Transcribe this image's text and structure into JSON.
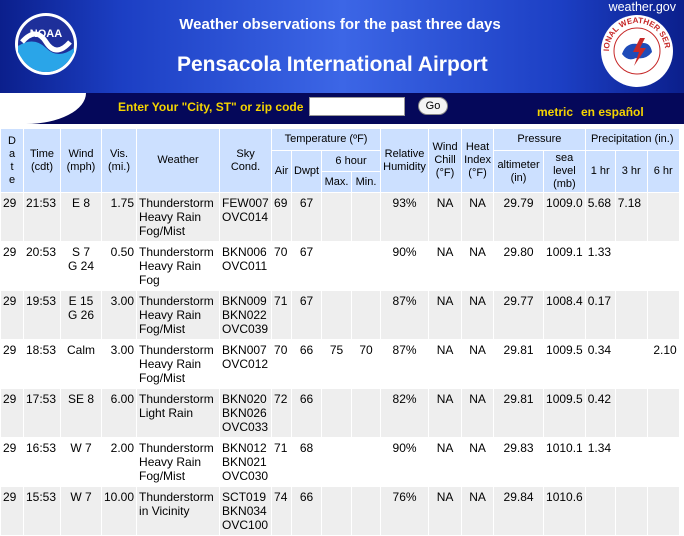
{
  "header": {
    "site_link": "weather.gov",
    "subtitle": "Weather observations for the past three days",
    "title": "Pensacola International Airport",
    "noaa_logo_text": "NOAA",
    "nws_logo_text": "NATIONAL WEATHER SERVICE"
  },
  "search": {
    "label": "Enter Your \"City, ST\" or zip code",
    "value": "",
    "go_label": "Go",
    "metric_label": "metric",
    "espanol_label": "en español"
  },
  "colors": {
    "header_blue": "#1c3fc4",
    "search_bar": "#05085a",
    "link_yellow": "#f5d400",
    "table_header": "#cce0ff",
    "row_shade": "#eeeeee"
  },
  "table": {
    "headers": {
      "date": [
        "D",
        "a",
        "t",
        "e"
      ],
      "time": [
        "Time",
        "(cdt)"
      ],
      "wind": [
        "Wind",
        "(mph)"
      ],
      "vis": [
        "Vis.",
        "(mi.)"
      ],
      "weather": "Weather",
      "sky": [
        "Sky",
        "Cond."
      ],
      "temperature": "Temperature (ºF)",
      "air": "Air",
      "dwpt": "Dwpt",
      "six_hour": "6 hour",
      "max": "Max.",
      "min": "Min.",
      "humidity": [
        "Relative",
        "Humidity"
      ],
      "wind_chill": [
        "Wind",
        "Chill",
        "(°F)"
      ],
      "heat_index": [
        "Heat",
        "Index",
        "(°F)"
      ],
      "pressure": "Pressure",
      "altimeter": [
        "altimeter",
        "(in)"
      ],
      "sea_level": [
        "sea",
        "level",
        "(mb)"
      ],
      "precipitation": "Precipitation (in.)",
      "p1": "1 hr",
      "p3": "3 hr",
      "p6": "6 hr"
    },
    "rows": [
      {
        "date": "29",
        "time": "21:53",
        "wind": [
          "E 8"
        ],
        "vis": "1.75",
        "weather": [
          "Thunderstorm",
          "Heavy Rain",
          "Fog/Mist"
        ],
        "sky": [
          "FEW007",
          "OVC014"
        ],
        "air": "69",
        "dwpt": "67",
        "max": "",
        "min": "",
        "humidity": "93%",
        "wind_chill": "NA",
        "heat_index": "NA",
        "altimeter": "29.79",
        "sea_level": "1009.0",
        "p1": "5.68",
        "p3": "7.18",
        "p6": ""
      },
      {
        "date": "29",
        "time": "20:53",
        "wind": [
          "S 7",
          "G 24"
        ],
        "vis": "0.50",
        "weather": [
          "Thunderstorm",
          "Heavy Rain",
          "Fog"
        ],
        "sky": [
          "BKN006",
          "OVC011"
        ],
        "air": "70",
        "dwpt": "67",
        "max": "",
        "min": "",
        "humidity": "90%",
        "wind_chill": "NA",
        "heat_index": "NA",
        "altimeter": "29.80",
        "sea_level": "1009.1",
        "p1": "1.33",
        "p3": "",
        "p6": ""
      },
      {
        "date": "29",
        "time": "19:53",
        "wind": [
          "E 15",
          "G 26"
        ],
        "vis": "3.00",
        "weather": [
          "Thunderstorm",
          "Heavy Rain",
          "Fog/Mist"
        ],
        "sky": [
          "BKN009",
          "BKN022",
          "OVC039"
        ],
        "air": "71",
        "dwpt": "67",
        "max": "",
        "min": "",
        "humidity": "87%",
        "wind_chill": "NA",
        "heat_index": "NA",
        "altimeter": "29.77",
        "sea_level": "1008.4",
        "p1": "0.17",
        "p3": "",
        "p6": ""
      },
      {
        "date": "29",
        "time": "18:53",
        "wind": [
          "Calm"
        ],
        "vis": "3.00",
        "weather": [
          "Thunderstorm",
          "Heavy Rain",
          "Fog/Mist"
        ],
        "sky": [
          "BKN007",
          "OVC012"
        ],
        "air": "70",
        "dwpt": "66",
        "max": "75",
        "min": "70",
        "humidity": "87%",
        "wind_chill": "NA",
        "heat_index": "NA",
        "altimeter": "29.81",
        "sea_level": "1009.5",
        "p1": "0.34",
        "p3": "",
        "p6": "2.10"
      },
      {
        "date": "29",
        "time": "17:53",
        "wind": [
          "SE 8"
        ],
        "vis": "6.00",
        "weather": [
          "Thunderstorm",
          "Light Rain"
        ],
        "sky": [
          "BKN020",
          "BKN026",
          "OVC033"
        ],
        "air": "72",
        "dwpt": "66",
        "max": "",
        "min": "",
        "humidity": "82%",
        "wind_chill": "NA",
        "heat_index": "NA",
        "altimeter": "29.81",
        "sea_level": "1009.5",
        "p1": "0.42",
        "p3": "",
        "p6": ""
      },
      {
        "date": "29",
        "time": "16:53",
        "wind": [
          "W 7"
        ],
        "vis": "2.00",
        "weather": [
          "Thunderstorm",
          "Heavy Rain",
          "Fog/Mist"
        ],
        "sky": [
          "BKN012",
          "BKN021",
          "OVC030"
        ],
        "air": "71",
        "dwpt": "68",
        "max": "",
        "min": "",
        "humidity": "90%",
        "wind_chill": "NA",
        "heat_index": "NA",
        "altimeter": "29.83",
        "sea_level": "1010.1",
        "p1": "1.34",
        "p3": "",
        "p6": ""
      },
      {
        "date": "29",
        "time": "15:53",
        "wind": [
          "W 7"
        ],
        "vis": "10.00",
        "weather": [
          "Thunderstorm",
          "in Vicinity"
        ],
        "sky": [
          "SCT019",
          "BKN034",
          "OVC100"
        ],
        "air": "74",
        "dwpt": "66",
        "max": "",
        "min": "",
        "humidity": "76%",
        "wind_chill": "NA",
        "heat_index": "NA",
        "altimeter": "29.84",
        "sea_level": "1010.6",
        "p1": "",
        "p3": "",
        "p6": ""
      }
    ]
  }
}
